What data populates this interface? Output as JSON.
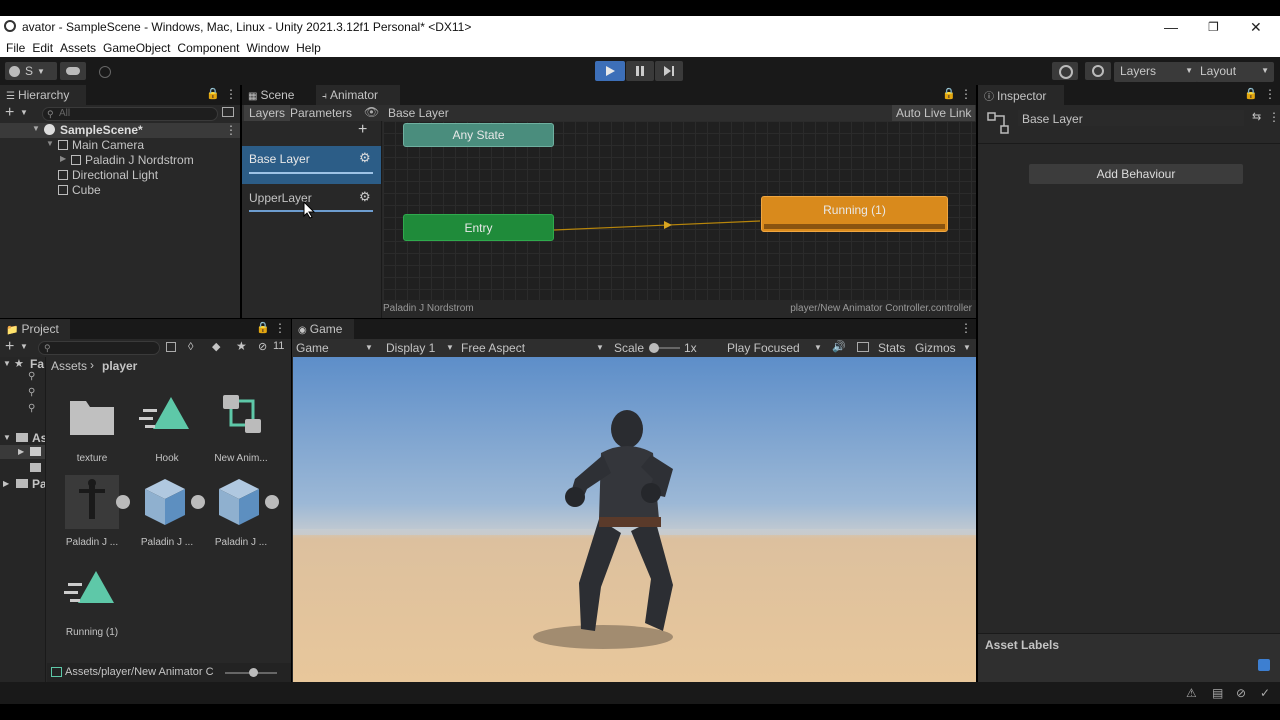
{
  "window": {
    "title": "avator - SampleScene - Windows, Mac, Linux - Unity 2021.3.12f1 Personal* <DX11>",
    "menu": [
      "File",
      "Edit",
      "Assets",
      "GameObject",
      "Component",
      "Window",
      "Help"
    ]
  },
  "toolbar": {
    "account_label": "S",
    "layers_label": "Layers",
    "layout_label": "Layout"
  },
  "hierarchy": {
    "tab": "Hierarchy",
    "search_placeholder": "All",
    "scene": "SampleScene*",
    "items": [
      "Main Camera",
      "Paladin J Nordstrom",
      "Directional Light",
      "Cube"
    ]
  },
  "animator": {
    "tabs": [
      "Scene",
      "Animator"
    ],
    "subtabs": [
      "Layers",
      "Parameters"
    ],
    "breadcrumb": "Base Layer",
    "auto_live_link": "Auto Live Link",
    "layers": [
      "Base Layer",
      "UpperLayer"
    ],
    "nodes": {
      "any_state": "Any State",
      "entry": "Entry",
      "running": "Running (1)"
    },
    "footer_left": "Paladin J Nordstrom",
    "footer_right": "player/New Animator Controller.controller"
  },
  "inspector": {
    "tab": "Inspector",
    "object_name": "Base Layer",
    "add_behaviour": "Add Behaviour",
    "asset_labels": "Asset Labels"
  },
  "project": {
    "tab": "Project",
    "hidden_count": "11",
    "tree": [
      "Fa",
      "As",
      "Pa"
    ],
    "breadcrumb": [
      "Assets",
      "player"
    ],
    "assets": [
      "texture",
      "Hook",
      "New Anim...",
      "Paladin J ...",
      "Paladin J ...",
      "Paladin J ...",
      "Running (1)"
    ],
    "footer_path": "Assets/player/New Animator C"
  },
  "game": {
    "tab": "Game",
    "view": "Game",
    "display": "Display 1",
    "aspect": "Free Aspect",
    "scale_label": "Scale",
    "scale_value": "1x",
    "play_mode": "Play Focused",
    "stats": "Stats",
    "gizmos": "Gizmos"
  },
  "colors": {
    "accent_blue": "#2c5d87",
    "entry_green": "#1f8b3a",
    "any_state_teal": "#4a8d7d",
    "running_orange": "#d98a1c",
    "play_blue": "#3d6fb8"
  }
}
